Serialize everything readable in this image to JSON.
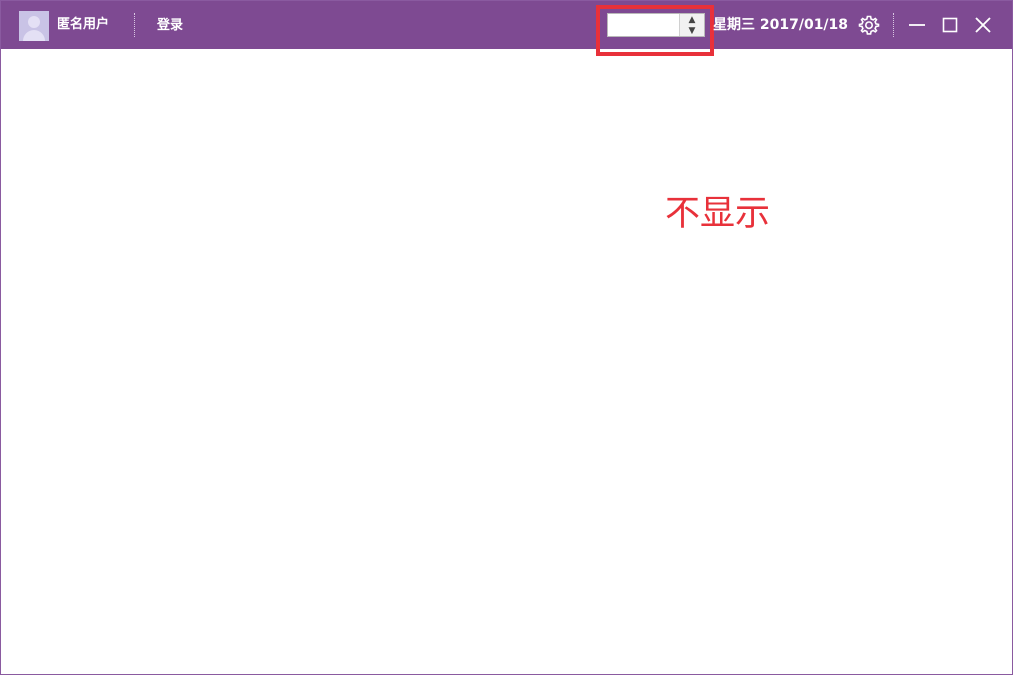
{
  "titlebar": {
    "username": "匿名用户",
    "login_label": "登录",
    "date_text": "星期三 2017/01/18",
    "select": {
      "value": "",
      "arrows_glyph": "▲▼"
    },
    "icons": {
      "avatar": "user-avatar-icon",
      "settings": "gear-icon",
      "minimize": "minimize-icon",
      "maximize": "maximize-icon",
      "close": "close-icon"
    },
    "background_color": "#7e4a92"
  },
  "main": {
    "annotation_text": "不显示",
    "annotation_color": "#e8313a",
    "highlight_color": "#e8313a"
  }
}
